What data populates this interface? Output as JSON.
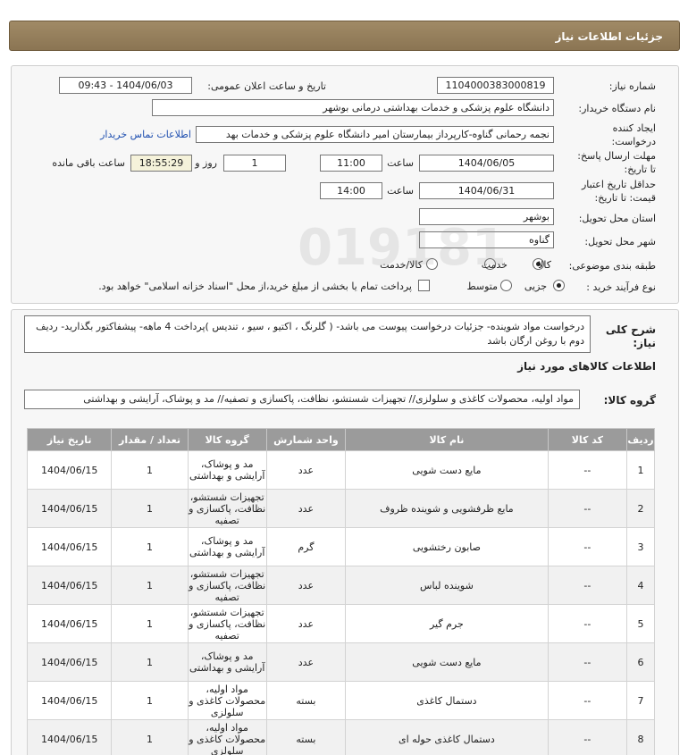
{
  "page": {
    "title": "جزئیات اطلاعات نیاز"
  },
  "form": {
    "need_number_label": "شماره نیاز:",
    "need_number": "1104000383000819",
    "announce_label": "تاریخ و ساعت اعلان عمومی:",
    "announce_value": "1404/06/03 - 09:43",
    "buyer_org_label": "نام دستگاه خریدار:",
    "buyer_org": "دانشگاه علوم پزشکی و خدمات بهداشتی درمانی بوشهر",
    "creator_label_1": "ایجاد کننده",
    "creator_label_2": "درخواست:",
    "creator": "نجمه رحمانی گناوه-کارپرداز بیمارستان امیر دانشگاه علوم پزشکی و خدمات بهد",
    "contact_link": "اطلاعات تماس خریدار",
    "deadline_label_1": "مهلت ارسال پاسخ:",
    "deadline_label_2": "تا تاریخ:",
    "deadline_date": "1404/06/05",
    "time_label": "ساعت",
    "deadline_time": "11:00",
    "days_value": "1",
    "days_label": "روز و",
    "remaining_time": "18:55:29",
    "remaining_label": "ساعت باقی مانده",
    "validity_label_1": "حداقل تاریخ اعتبار",
    "validity_label_2": "قیمت: تا تاریخ:",
    "validity_date": "1404/06/31",
    "validity_time": "14:00",
    "province_label": "استان محل تحویل:",
    "province": "بوشهر",
    "city_label": "شهر محل تحویل:",
    "city": "گناوه",
    "category_label": "طبقه بندی موضوعی:",
    "category_options": [
      "کالا",
      "خدمت",
      "کالا/خدمت"
    ],
    "process_label": "نوع فرآیند خرید :",
    "process_options": [
      "جزیی",
      "متوسط"
    ],
    "payment_note": "پرداخت تمام یا بخشی از مبلغ خرید،از محل \"اسناد خزانه اسلامی\" خواهد بود."
  },
  "description": {
    "label_1": "شرح کلی",
    "label_2": "نیاز:",
    "text": "درخواست مواد شوینده- جزئیات درخواست پیوست می باشد- ( گلرنگ ، اکتیو ، سیو ، تندیس )پرداخت 4 ماهه- پیشفاکتور بگذارید- ردیف دوم با روغن ارگان باشد"
  },
  "goods": {
    "section_title": "اطلاعات کالاهای مورد نیاز",
    "group_label": "گروه کالا:",
    "group_value": "مواد اولیه، محصولات کاغذی و سلولزی// تجهیزات شستشو، نظافت، پاکسازی و تصفیه// مد و پوشاک، آرایشی و بهداشتی",
    "columns": [
      "ردیف",
      "کد کالا",
      "نام کالا",
      "واحد شمارش",
      "گروه کالا",
      "تعداد / مقدار",
      "تاریخ نیاز"
    ],
    "rows": [
      {
        "row": "1",
        "code": "--",
        "name": "مایع دست شویی",
        "unit": "عدد",
        "group": "مد و پوشاک، آرایشی و بهداشتی",
        "qty": "1",
        "date": "1404/06/15"
      },
      {
        "row": "2",
        "code": "--",
        "name": "مایع ظرفشویی و شوینده ظروف",
        "unit": "عدد",
        "group": "تجهیزات شستشو، نظافت، پاکسازی و تصفیه",
        "qty": "1",
        "date": "1404/06/15"
      },
      {
        "row": "3",
        "code": "--",
        "name": "صابون رختشویی",
        "unit": "گرم",
        "group": "مد و پوشاک، آرایشی و بهداشتی",
        "qty": "1",
        "date": "1404/06/15"
      },
      {
        "row": "4",
        "code": "--",
        "name": "شوینده لباس",
        "unit": "عدد",
        "group": "تجهیزات شستشو، نظافت، پاکسازی و تصفیه",
        "qty": "1",
        "date": "1404/06/15"
      },
      {
        "row": "5",
        "code": "--",
        "name": "جرم گیر",
        "unit": "عدد",
        "group": "تجهیزات شستشو، نظافت، پاکسازی و تصفیه",
        "qty": "1",
        "date": "1404/06/15"
      },
      {
        "row": "6",
        "code": "--",
        "name": "مایع دست شویی",
        "unit": "عدد",
        "group": "مد و پوشاک، آرایشی و بهداشتی",
        "qty": "1",
        "date": "1404/06/15"
      },
      {
        "row": "7",
        "code": "--",
        "name": "دستمال کاغذی",
        "unit": "بسته",
        "group": "مواد اولیه، محصولات کاغذی و سلولزی",
        "qty": "1",
        "date": "1404/06/15"
      },
      {
        "row": "8",
        "code": "--",
        "name": "دستمال کاغذی حوله ای",
        "unit": "بسته",
        "group": "مواد اولیه، محصولات کاغذی و سلولزی",
        "qty": "1",
        "date": "1404/06/15"
      }
    ]
  }
}
